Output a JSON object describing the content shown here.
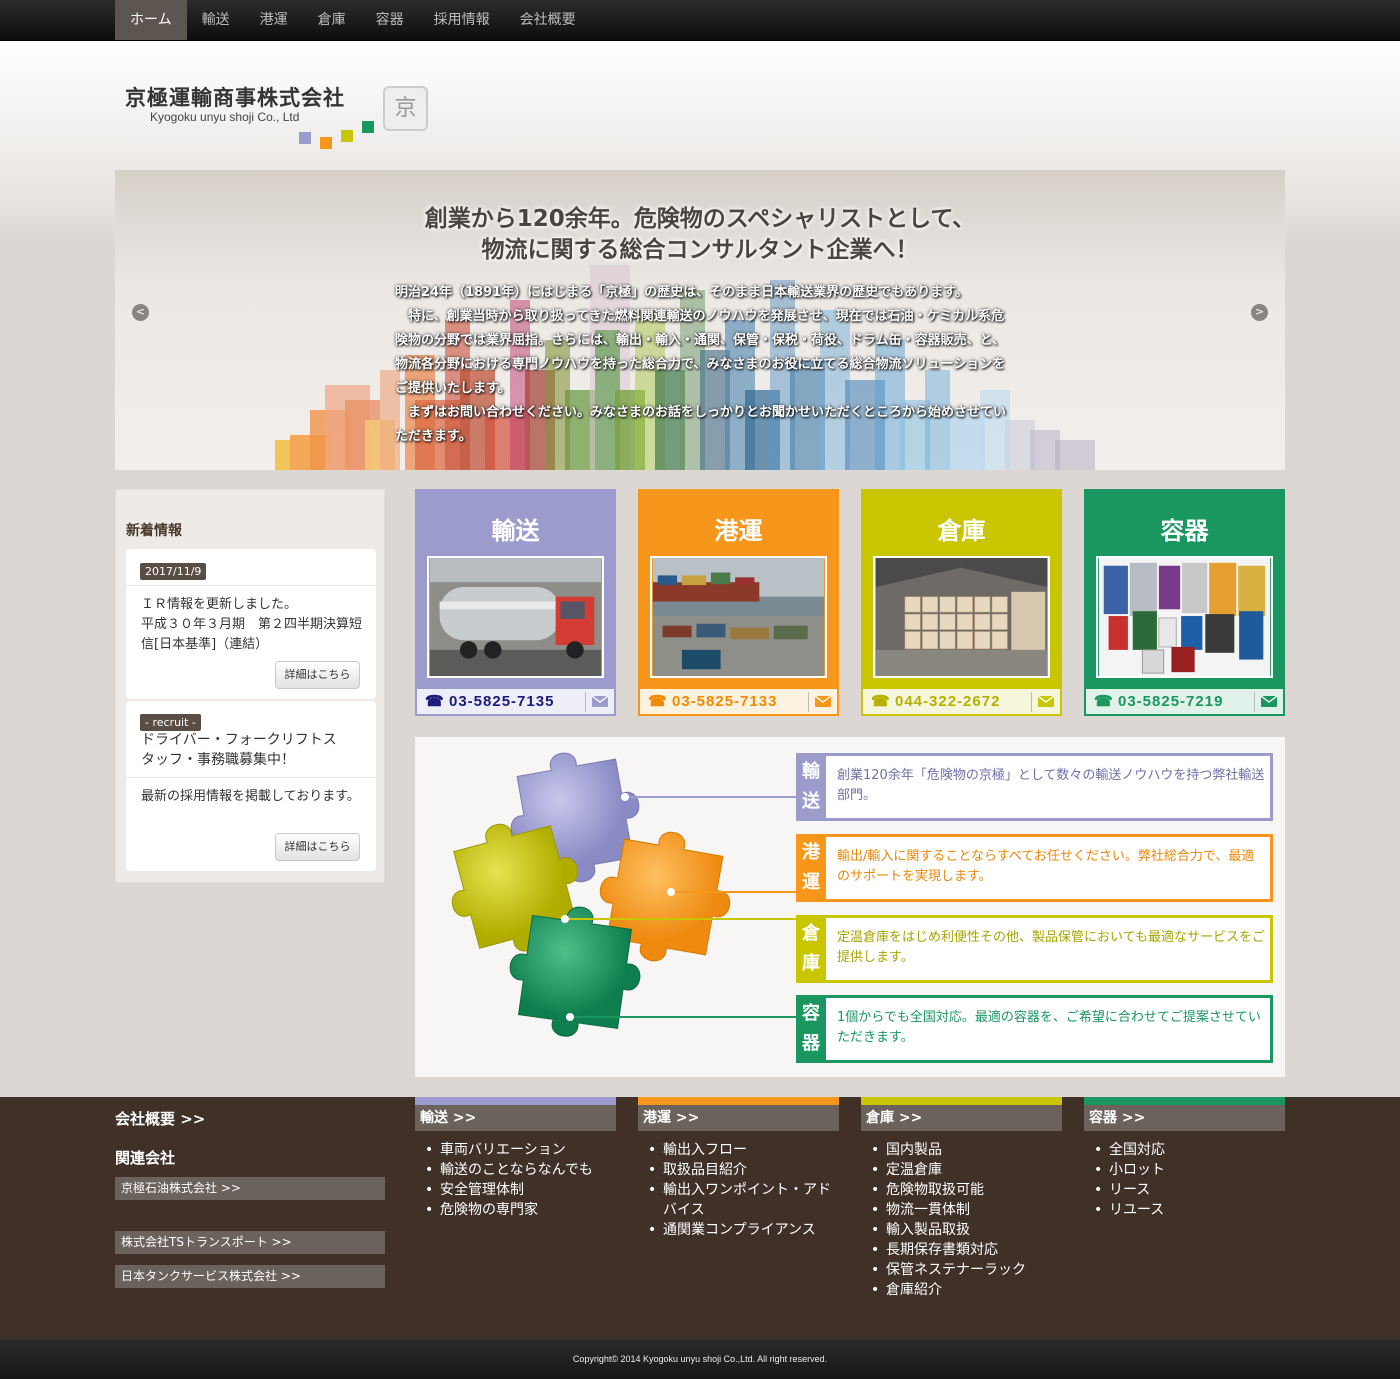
{
  "nav": {
    "items": [
      "ホーム",
      "輸送",
      "港運",
      "倉庫",
      "容器",
      "採用情報",
      "会社概要"
    ],
    "active": "ホーム"
  },
  "logo": {
    "name_jp": "京極運輸商事株式会社",
    "name_en": "Kyogoku unyu shoji Co., Ltd",
    "seal_glyph": "京"
  },
  "hero": {
    "title_line1": "創業から120余年。危険物のスペシャリストとして、",
    "title_line2": "物流に関する総合コンサルタント企業へ！",
    "para1": "明治24年（1891年）にはじまる「京極」の歴史は、そのまま日本輸送業界の歴史でもあります。",
    "para2": "　特に、創業当時から取り扱ってきた燃料関連輸送のノウハウを発展させ、現在では石油・ケミカル系危険物の分野では業界屈指。さらには、輸出・輸入・通関、保管・保税・荷役、ドラム缶・容器販売、と、物流各分野における専門ノウハウを持った総合力で、みなさまのお役に立てる総合物流ソリューションをご提供いたします。",
    "para3": "　まずはお問い合わせください。みなさまのお話をしっかりとお聞かせいただくところから始めさせていただきます。",
    "prev": "<",
    "next": ">"
  },
  "news": {
    "title": "新着情報",
    "items": [
      {
        "tag": "2017/11/9",
        "text": "ＩＲ情報を更新しました。\n平成３０年３月期　第２四半期決算短信[日本基準]（連結）",
        "button": "詳細はこちら"
      },
      {
        "tag": "- recruit -",
        "headline": "ドライバー・フォークリフトスタッフ・事務職募集中！",
        "text": "最新の採用情報を掲載しております。",
        "button": "詳細はこちら"
      }
    ]
  },
  "services": [
    {
      "title": "輸送",
      "phone": "03-5825-7135",
      "color": "#9b9bcc",
      "dark": "#1b1b7a",
      "light": "#eeeef8"
    },
    {
      "title": "港運",
      "phone": "03-5825-7133",
      "color": "#f6961b",
      "dark": "#f08a00",
      "light": "#fdf1e0"
    },
    {
      "title": "倉庫",
      "phone": "044-322-2672",
      "color": "#c9c600",
      "dark": "#b3b000",
      "light": "#f6f6dd"
    },
    {
      "title": "容器",
      "phone": "03-5825-7219",
      "color": "#1a9660",
      "dark": "#1a9660",
      "light": "#e0f2ea"
    }
  ],
  "puzzle": [
    {
      "label1": "輸",
      "label2": "送",
      "text": "創業120余年「危険物の京極」として数々の輸送ノウハウを持つ弊社輸送部門。",
      "color": "#9b9bcc",
      "textcolor": "#6f6fa8"
    },
    {
      "label1": "港",
      "label2": "運",
      "text": "輸出/輸入に関することならすべてお任せください。弊社総合力で、最適のサポートを実現します。",
      "color": "#f6961b",
      "textcolor": "#e8870d"
    },
    {
      "label1": "倉",
      "label2": "庫",
      "text": "定温倉庫をはじめ利便性その他、製品保管においても最適なサービスをご提供します。",
      "color": "#c9c600",
      "textcolor": "#a7a400"
    },
    {
      "label1": "容",
      "label2": "器",
      "text": "1個からでも全国対応。最適の容器を、ご希望に合わせてご提案させていただきます。",
      "color": "#1a9660",
      "textcolor": "#1a9660"
    }
  ],
  "footer": {
    "company": "会社概要 >>",
    "related_title": "関連会社",
    "related": [
      "京極石油株式会社 >>",
      "株式会社TSトランスポート >>",
      "日本タンクサービス株式会社 >>"
    ],
    "columns": [
      {
        "head": "輸送 >>",
        "color": "#9b9bcc",
        "items": [
          "車両バリエーション",
          "輸送のことならなんでも",
          "安全管理体制",
          "危険物の専門家"
        ]
      },
      {
        "head": "港運 >>",
        "color": "#f6961b",
        "items": [
          "輸出入フロー",
          "取扱品目紹介",
          "輸出入ワンポイント・アドバイス",
          "通関業コンプライアンス"
        ]
      },
      {
        "head": "倉庫 >>",
        "color": "#c9c600",
        "items": [
          "国内製品",
          "定温倉庫",
          "危険物取扱可能",
          "物流一貫体制",
          "輸入製品取扱",
          "長期保存書類対応",
          "保管ネステナーラック",
          "倉庫紹介"
        ]
      },
      {
        "head": "容器 >>",
        "color": "#1a9660",
        "items": [
          "全国対応",
          "小ロット",
          "リース",
          "リユース"
        ]
      }
    ],
    "copyright": "Copyright© 2014 Kyogoku unyu shoji Co.,Ltd. All right reserved."
  }
}
